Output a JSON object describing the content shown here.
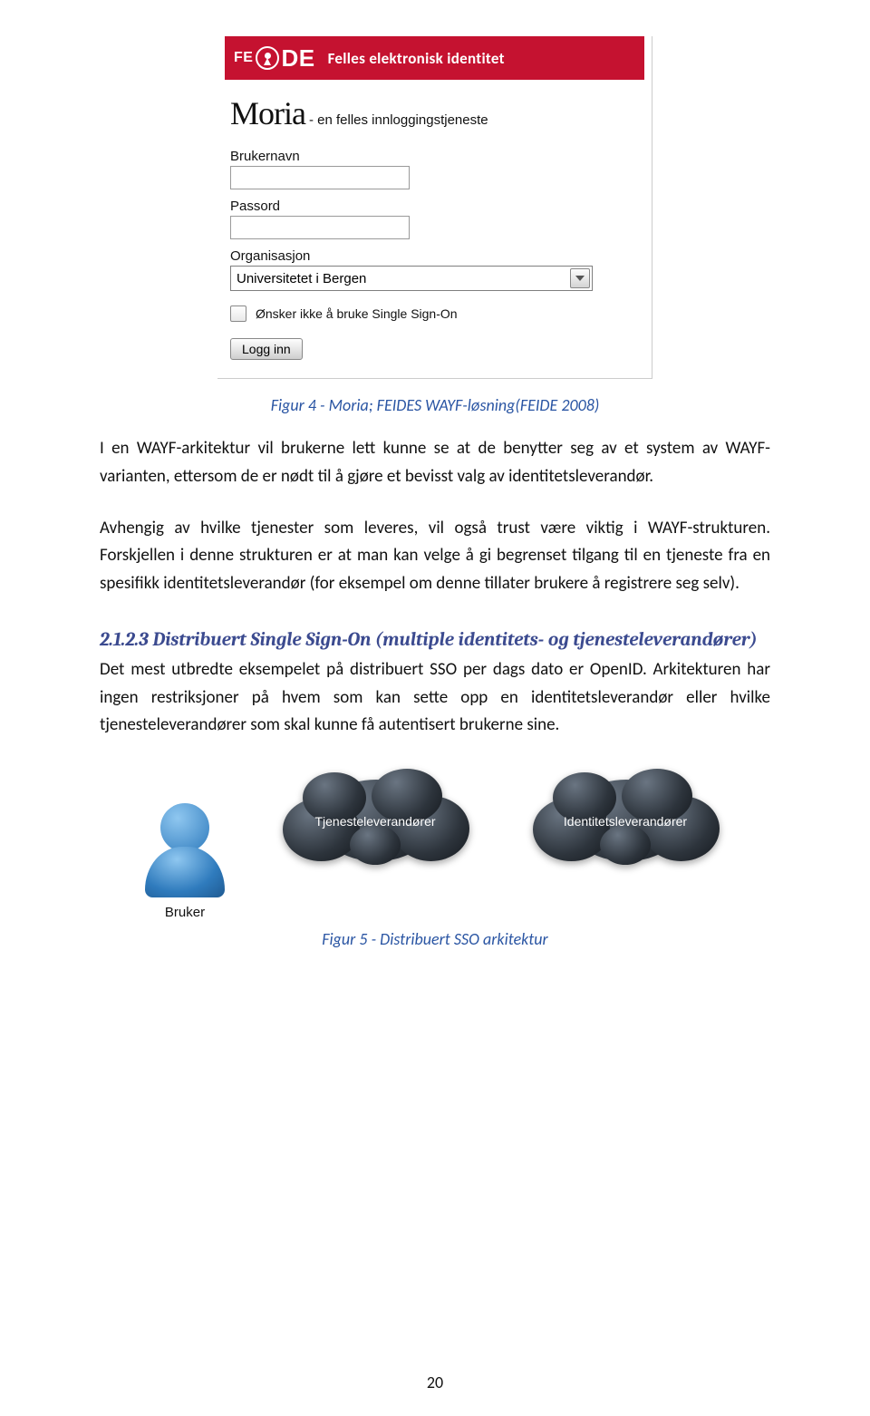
{
  "login_panel": {
    "banner_brand": "FEIDE",
    "banner_subtitle": "Felles elektronisk identitet",
    "moria_brand": "Moria",
    "moria_tagline": "- en felles innloggingstjeneste",
    "username_label": "Brukernavn",
    "username_value": "",
    "password_label": "Passord",
    "password_value": "",
    "organisation_label": "Organisasjon",
    "organisation_value": "Universitetet i Bergen",
    "sso_checkbox_label": "Ønsker ikke å bruke Single Sign-On",
    "login_button": "Logg inn"
  },
  "figure4_caption": "Figur 4 - Moria; FEIDES WAYF-løsning(FEIDE 2008)",
  "paragraph1": "I en WAYF-arkitektur vil brukerne lett kunne se at de benytter seg av et system av WAYF-varianten, ettersom de er nødt til å gjøre et bevisst valg av identitetsleverandør.",
  "paragraph2": "Avhengig av hvilke tjenester som leveres, vil også trust være viktig i WAYF-strukturen. Forskjellen i denne strukturen er at man kan velge å gi begrenset tilgang til en tjeneste fra en spesifikk identitetsleverandør (for eksempel om denne tillater brukere å registrere seg selv).",
  "section_heading": "2.1.2.3 Distribuert Single Sign-On (multiple identitets- og tjenesteleverandører)",
  "paragraph3": "Det mest utbredte eksempelet på distribuert SSO per dags dato er OpenID. Arkitekturen har ingen restriksjoner på hvem som kan sette opp en identitetsleverandør eller hvilke tjenesteleverandører som skal kunne få autentisert brukerne sine.",
  "diagram": {
    "user_label": "Bruker",
    "cloud1_label": "Tjenesteleverandører",
    "cloud2_label": "Identitetsleverandører"
  },
  "figure5_caption": "Figur 5 - Distribuert SSO arkitektur",
  "page_number": "20"
}
